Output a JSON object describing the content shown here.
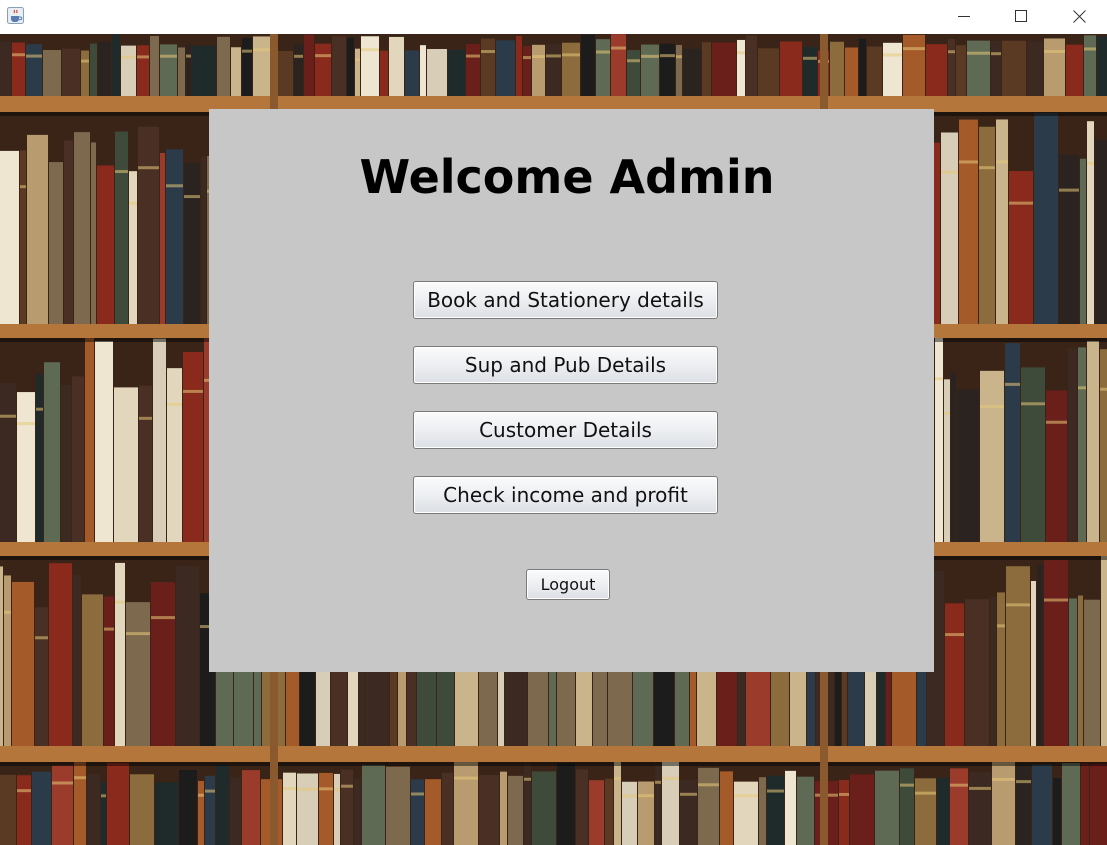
{
  "window": {
    "app_icon": "java-cup-icon",
    "controls": {
      "minimize_icon": "minimize-icon",
      "maximize_icon": "maximize-icon",
      "close_icon": "close-icon"
    }
  },
  "background": {
    "image": "bookshelf"
  },
  "panel": {
    "title": "Welcome Admin",
    "buttons": [
      "Book and Stationery details",
      "Sup and Pub Details",
      "Customer Details",
      "Check income and profit"
    ],
    "logout_label": "Logout"
  },
  "colors": {
    "panel_bg": "#c7c7c7",
    "shelf_wood": "#b5763c",
    "shelf_dark": "#3a2418"
  }
}
